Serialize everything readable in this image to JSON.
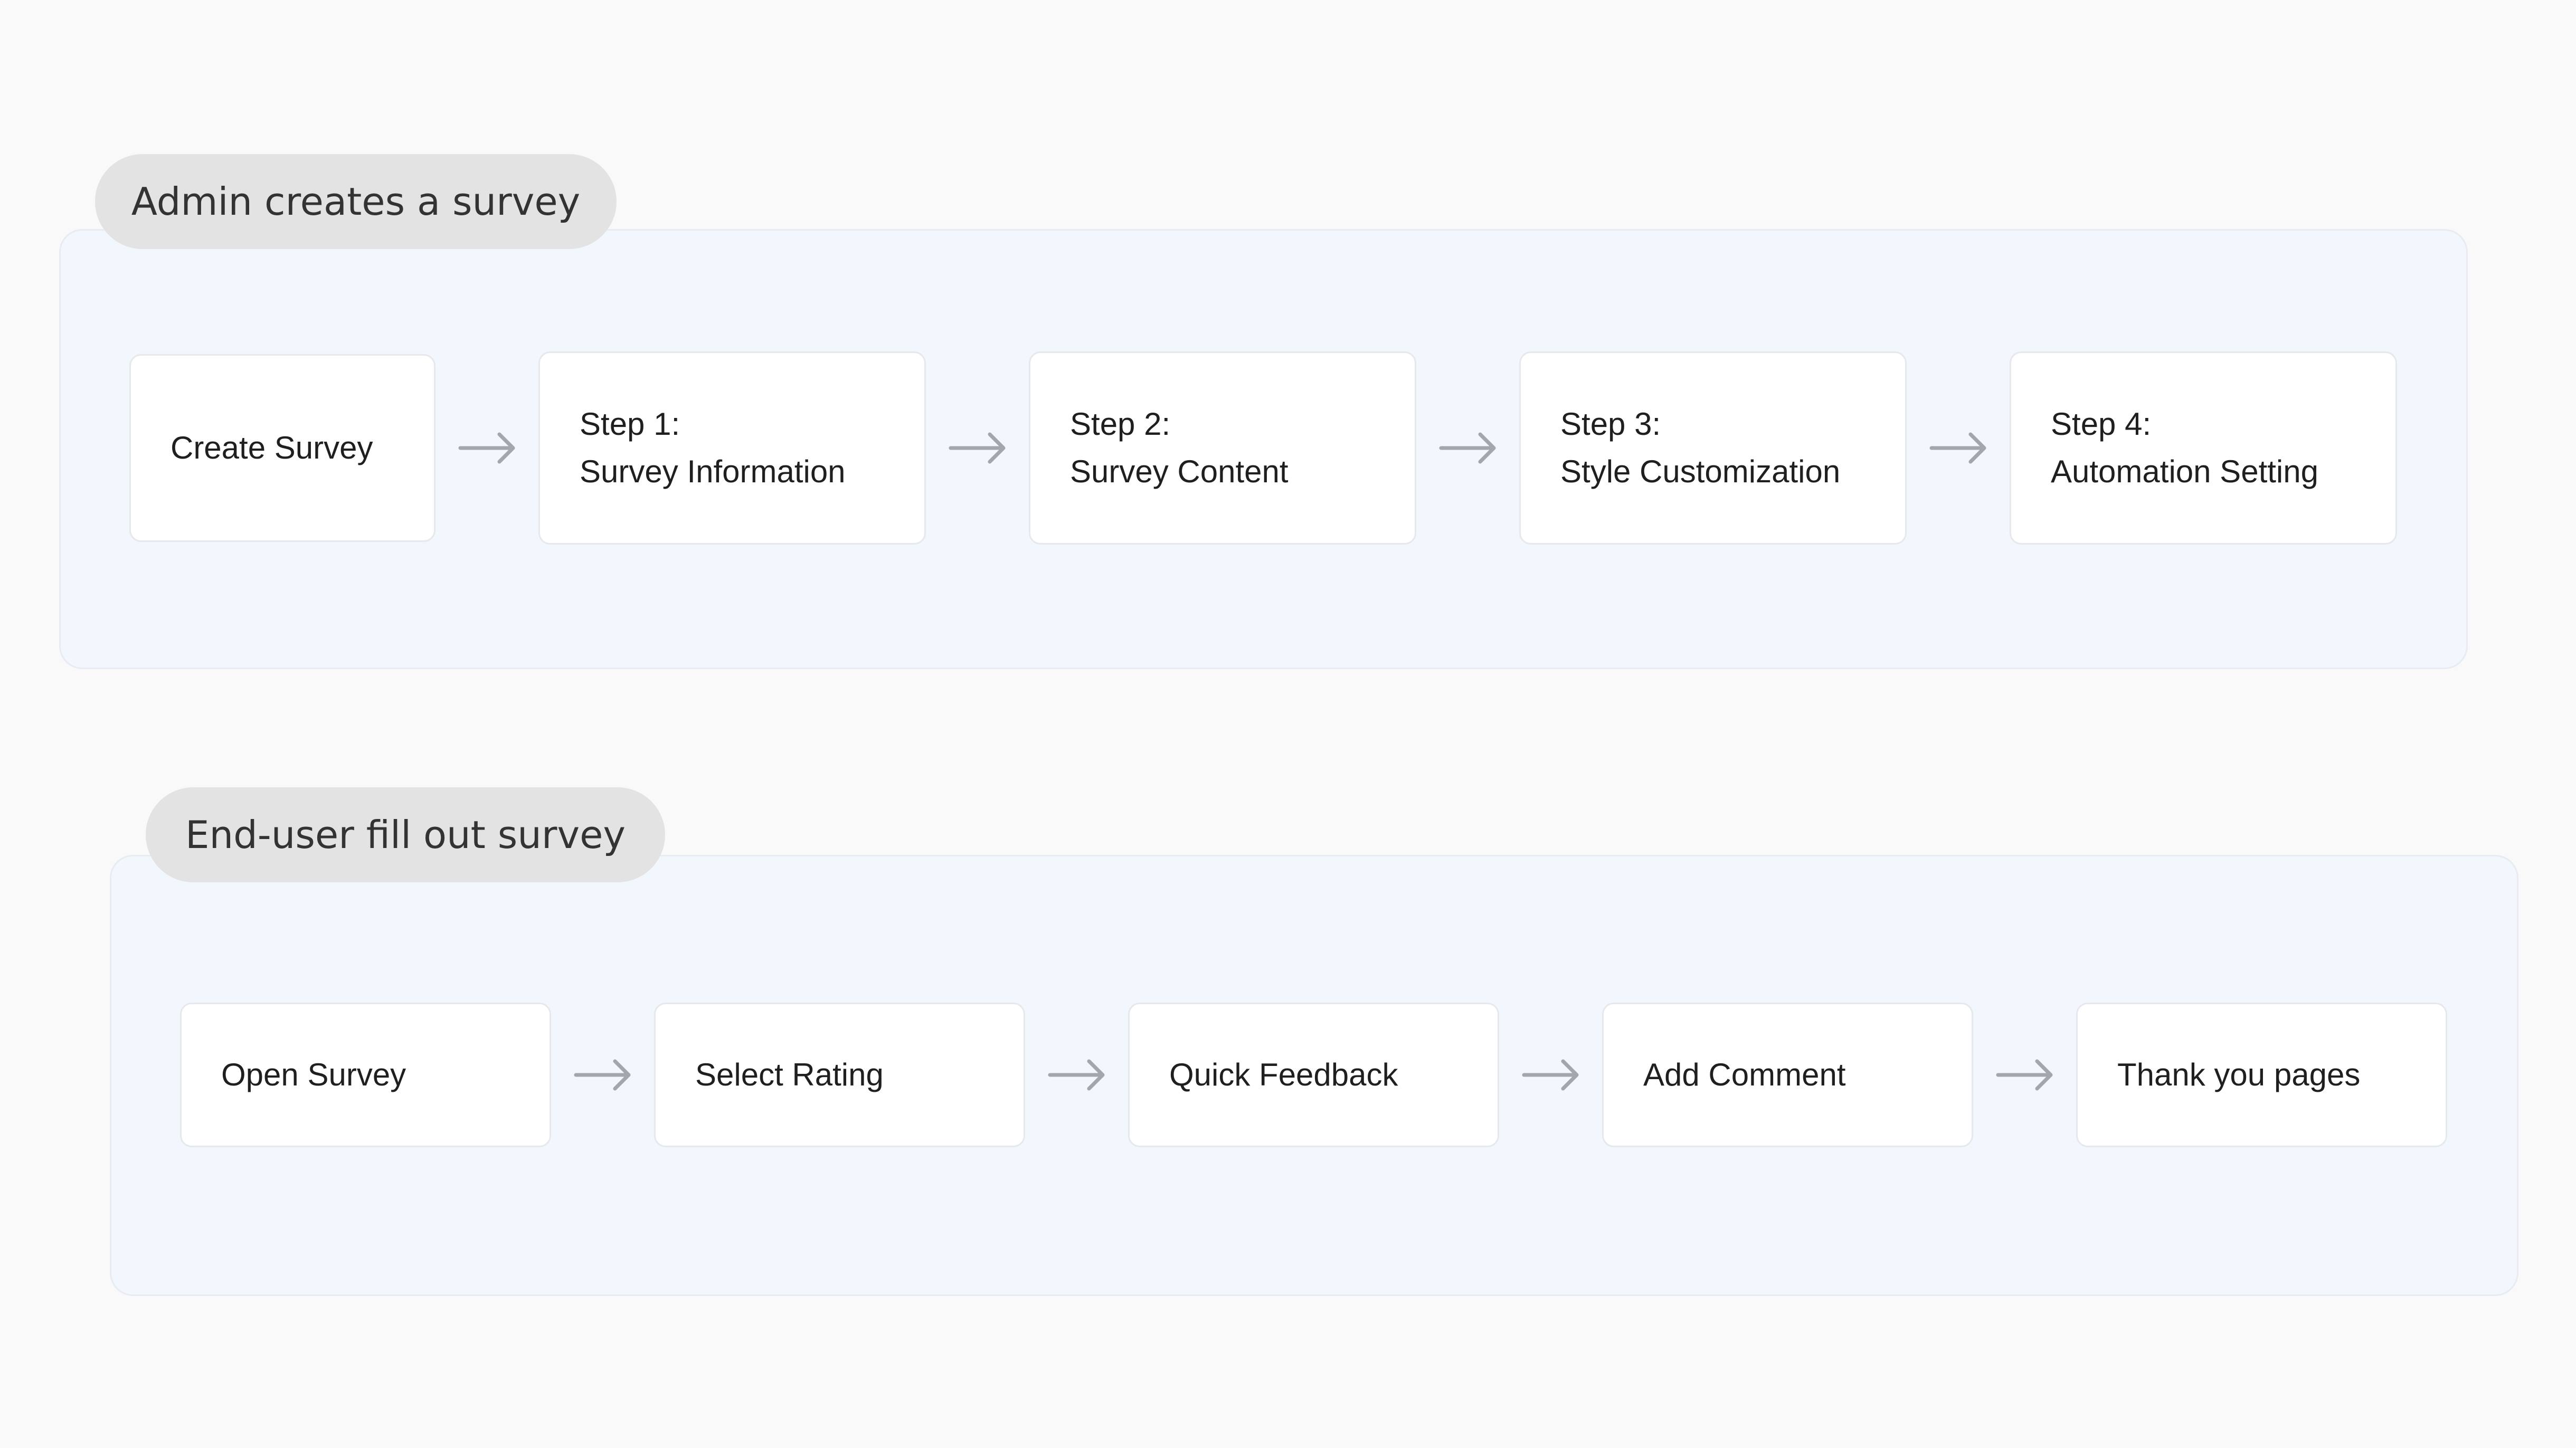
{
  "colors": {
    "background": "#f9f9f9",
    "panel_fill": "#f2f6fd",
    "panel_border": "#e8ecf2",
    "pill_fill": "#e3e3e3",
    "node_fill": "#ffffff",
    "node_border": "#e6e8ec",
    "arrow": "#a3a6ab"
  },
  "admin_flow": {
    "title": "Admin creates a survey",
    "steps": [
      {
        "line1": "Create Survey",
        "line2": ""
      },
      {
        "line1": "Step 1:",
        "line2": "Survey Information"
      },
      {
        "line1": "Step 2:",
        "line2": "Survey Content"
      },
      {
        "line1": "Step 3:",
        "line2": "Style Customization"
      },
      {
        "line1": "Step 4:",
        "line2": "Automation Setting"
      }
    ]
  },
  "enduser_flow": {
    "title": "End-user fill out survey",
    "steps": [
      {
        "line1": "Open Survey"
      },
      {
        "line1": "Select Rating"
      },
      {
        "line1": "Quick Feedback"
      },
      {
        "line1": "Add Comment"
      },
      {
        "line1": "Thank you pages"
      }
    ]
  }
}
